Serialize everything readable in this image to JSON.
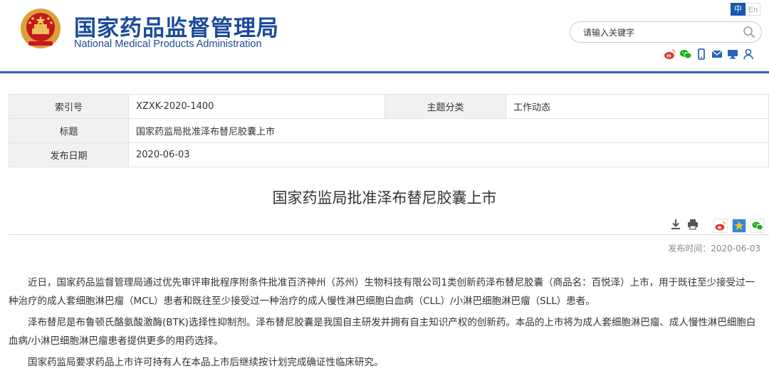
{
  "header": {
    "site_title_cn": "国家药品监督管理局",
    "site_title_en": "National Medical Products Administration",
    "lang": {
      "zh": "中",
      "en": "En"
    },
    "search": {
      "placeholder": "请输入关键字"
    },
    "social_icons": [
      "weibo-icon",
      "wechat-icon",
      "mobile-icon",
      "mail-icon",
      "monitor-icon",
      "user-icon"
    ],
    "accent_color": "#1b4a9a"
  },
  "info": {
    "index_label": "索引号",
    "index_value": "XZXK-2020-1400",
    "category_label": "主题分类",
    "category_value": "工作动态",
    "title_label": "标题",
    "title_value": "国家药监局批准泽布替尼胶囊上市",
    "date_label": "发布日期",
    "date_value": "2020-06-03"
  },
  "article": {
    "title": "国家药监局批准泽布替尼胶囊上市",
    "publish_time": "发布时间：2020-06-03",
    "tools": [
      "download-icon",
      "print-icon",
      "weibo-share-icon",
      "qzone-share-icon",
      "wechat-share-icon"
    ],
    "paragraphs": [
      "近日，国家药品监督管理局通过优先审评审批程序附条件批准百济神州（苏州）生物科技有限公司1类创新药泽布替尼胶囊（商品名：百悦泽）上市，用于既往至少接受过一种治疗的成人套细胞淋巴瘤（MCL）患者和既往至少接受过一种治疗的成人慢性淋巴细胞白血病（CLL）/小淋巴细胞淋巴瘤（SLL）患者。",
      "泽布替尼是布鲁顿氏酪氨酸激酶(BTK)选择性抑制剂。泽布替尼胶囊是我国自主研发并拥有自主知识产权的创新药。本品的上市将为成人套细胞淋巴瘤、成人慢性淋巴细胞白血病/小淋巴细胞淋巴瘤患者提供更多的用药选择。",
      "国家药监局要求药品上市许可持有人在本品上市后继续按计划完成确证性临床研究。"
    ]
  }
}
